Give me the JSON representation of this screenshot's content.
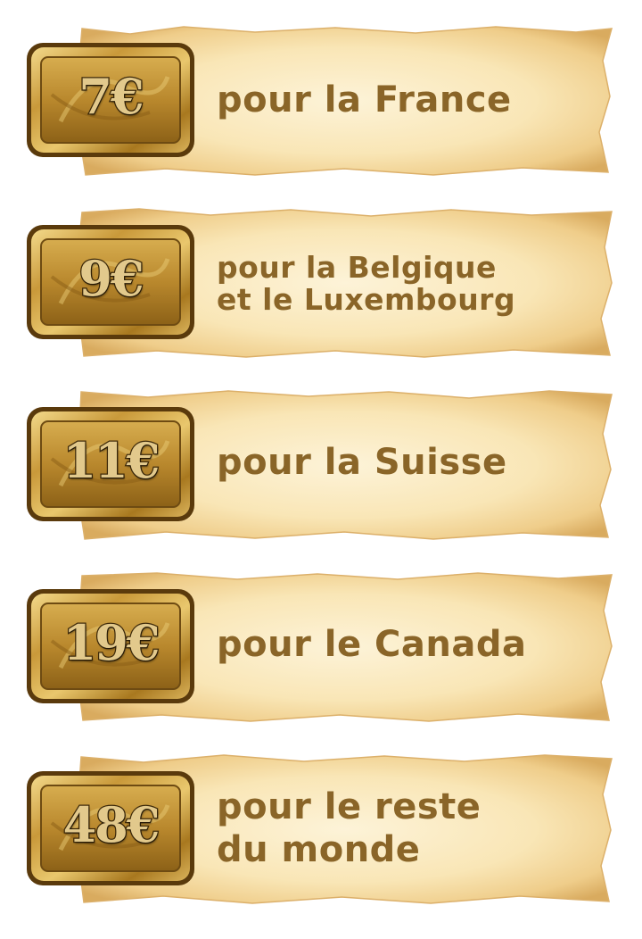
{
  "colors": {
    "parchment_light": "#fbecc6",
    "parchment_edge": "#d9ae67",
    "text_brown": "#8a6528",
    "plaque_gold": "#c99a3a",
    "plaque_dark": "#6e4b12"
  },
  "icons": [
    "gold-plaque-icon",
    "parchment-banner-icon"
  ],
  "shipping_rates": [
    {
      "price": "7€",
      "lines": [
        "pour la France"
      ]
    },
    {
      "price": "9€",
      "lines": [
        "pour la Belgique",
        "et le Luxembourg"
      ]
    },
    {
      "price": "11€",
      "lines": [
        "pour la Suisse"
      ]
    },
    {
      "price": "19€",
      "lines": [
        "pour le Canada"
      ]
    },
    {
      "price": "48€",
      "lines": [
        "pour le reste",
        "du monde"
      ]
    }
  ]
}
